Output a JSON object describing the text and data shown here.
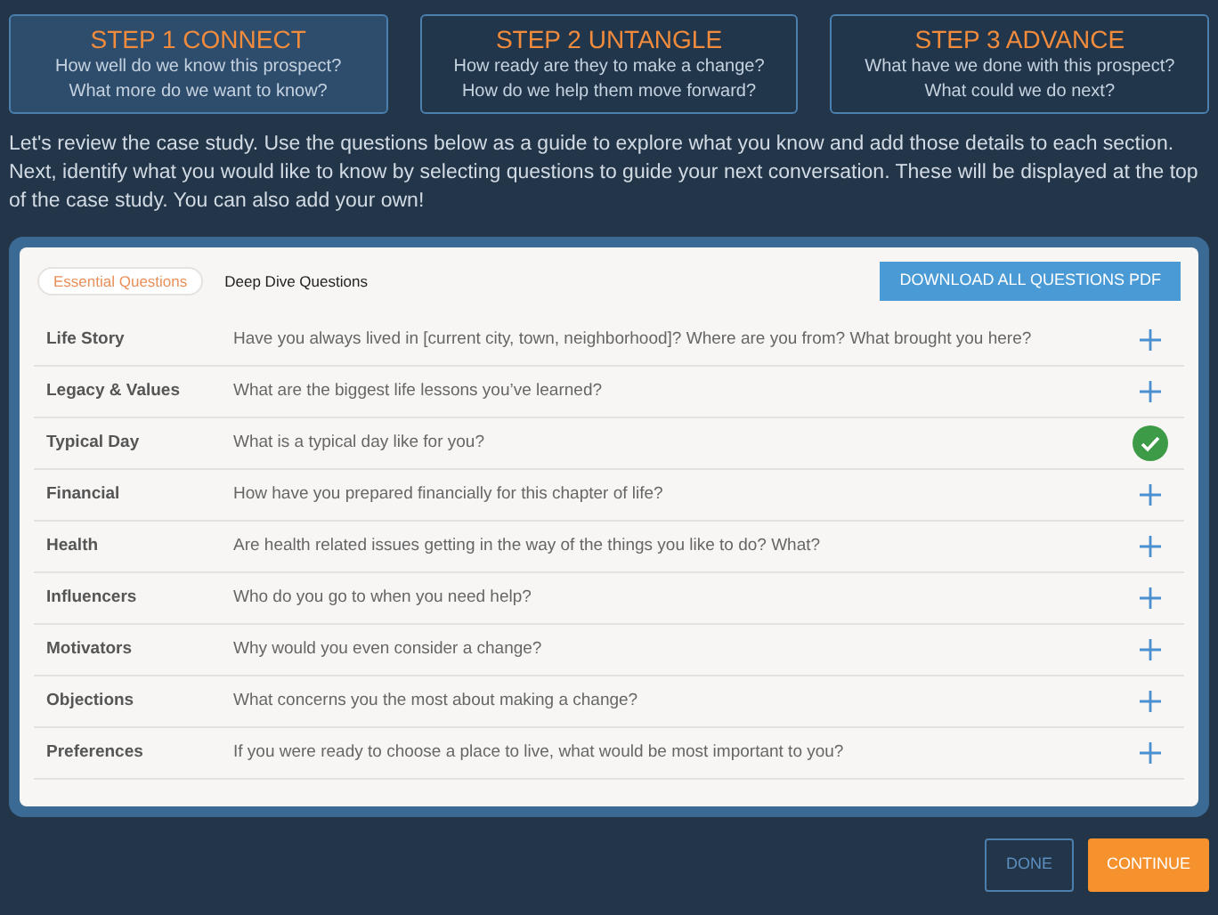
{
  "steps": [
    {
      "title": "STEP 1 CONNECT",
      "lines": [
        "How well do we know this prospect?",
        "What more do we want to know?"
      ],
      "selected": true
    },
    {
      "title": "STEP 2 UNTANGLE",
      "lines": [
        "How ready are they to make a change?",
        "How do we help them move forward?"
      ],
      "selected": false
    },
    {
      "title": "STEP 3 ADVANCE",
      "lines": [
        "What have we done with this prospect?",
        "What could we do next?"
      ],
      "selected": false
    }
  ],
  "intro": "Let's review the case study. Use the questions below as a guide to explore what you know and add those details to each section. Next, identify what you would like to know by selecting questions to guide your next conversation. These will be displayed at the top of the case study. You can also add your own!",
  "tabs": [
    {
      "label": "Essential Questions",
      "selected": true
    },
    {
      "label": "Deep Dive Questions",
      "selected": false
    }
  ],
  "download_button": "DOWNLOAD ALL QUESTIONS PDF",
  "questions": [
    {
      "topic": "Life Story",
      "question": "Have you always lived in [current city, town, neighborhood]? Where are you from? What brought you here?",
      "checked": false
    },
    {
      "topic": "Legacy & Values",
      "question": "What are the biggest life lessons you’ve learned?",
      "checked": false
    },
    {
      "topic": "Typical Day",
      "question": "What is a typical day like for you?",
      "checked": true
    },
    {
      "topic": "Financial",
      "question": "How have you prepared financially for this chapter of life?",
      "checked": false
    },
    {
      "topic": "Health",
      "question": "Are health related issues getting in the way of the things you like to do? What?",
      "checked": false
    },
    {
      "topic": "Influencers",
      "question": "Who do you go to when you need help?",
      "checked": false
    },
    {
      "topic": "Motivators",
      "question": "Why would you even consider a change?",
      "checked": false
    },
    {
      "topic": "Objections",
      "question": "What concerns you the most about making a change?",
      "checked": false
    },
    {
      "topic": "Preferences",
      "question": "If you were ready to choose a place to live, what would be most important to you?",
      "checked": false
    }
  ],
  "buttons": {
    "done": "DONE",
    "continue": "CONTINUE"
  }
}
